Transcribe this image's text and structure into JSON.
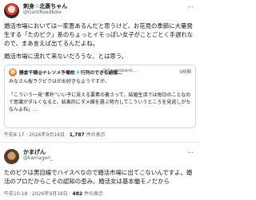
{
  "tweet1": {
    "display_name": "刺身☆北斎ちゃん",
    "handle": "@GantRoadbike",
    "more_icon": "⋯",
    "text": "婚活市場においては一家恩あるんだと思うけど、お花見の季節に大量発生する「たのピク」系のちょっとイモっぽい女子がことごとく手遅れなので、まあ言えば出てるんだよね。",
    "text2": "婚活市場に流れて来ないだろうな、とは思う。",
    "quote": {
      "display_name": "勝倉千穂@ナレソメ予備校🎐行列のできる結婚…",
      "handle": "@Cryptobank…",
      "time": "9時間",
      "sub": "みなさん桜ラクピクはがお好きなようですが、",
      "text": "「こういう一見“素朴”いい子に見える要素の裏さって、結婚生活では毎日のことなので意識がダルくなると、結果的にダメ線を選ぶ努力してこういうところを見逃しがちなんよね」…"
    },
    "time": "午前8:17",
    "date": "2026年9月18日",
    "views": "1,787",
    "views_label": "件の表示"
  },
  "tweet2": {
    "display_name": "かまげん",
    "handle": "@kamagen_",
    "more_icon": "⋯",
    "text": "たのピクは男目線でハイスペなので婚活市場に出てこないんですよ。婚活のプロだからこその認知の歪み。婚活女は基本働モノだから",
    "time": "午前10:18",
    "date": "2026年9月18日",
    "views": "482",
    "views_label": "件の表示"
  }
}
